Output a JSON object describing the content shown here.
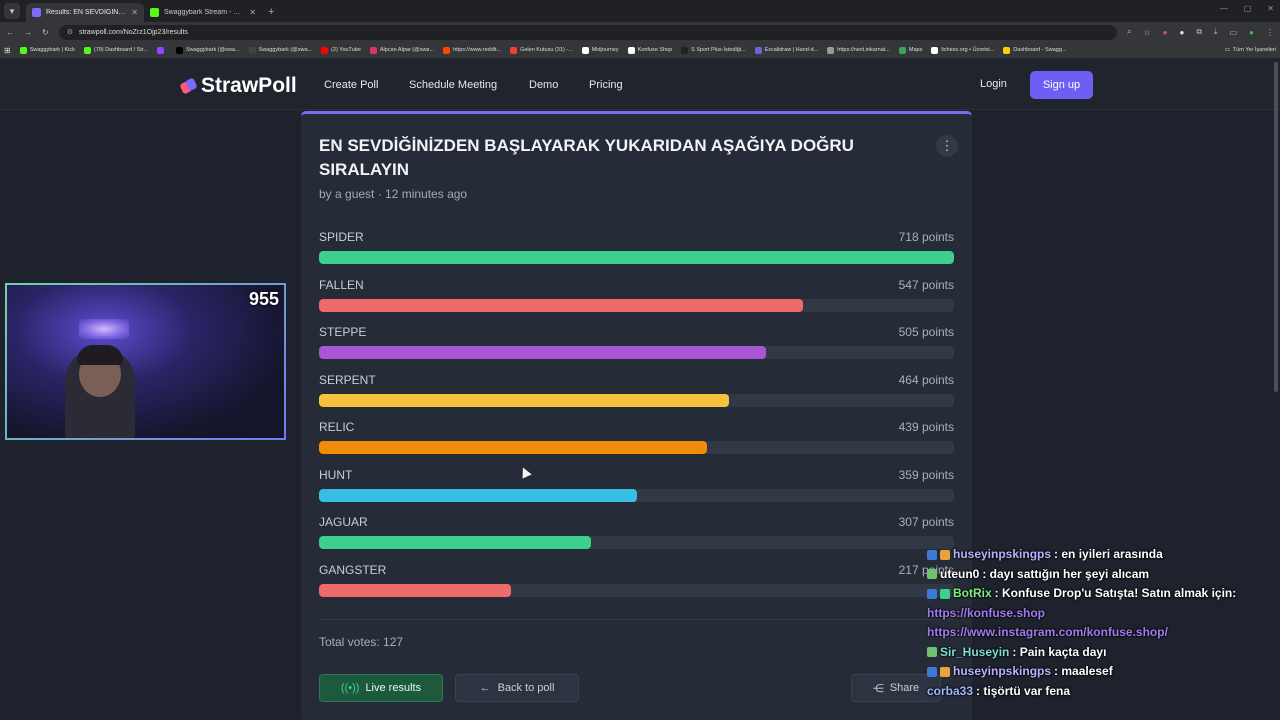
{
  "browser": {
    "tabs": [
      {
        "title": "Results: EN SEVDIĞINIZDEN BAŞ",
        "active": true,
        "favicon_color": "#7a6cf7"
      },
      {
        "title": "Swaggybark Stream - Watch Li...",
        "active": false,
        "favicon_color": "#53fc18"
      }
    ],
    "new_tab": "+",
    "url": "strawpoll.com/NoZrz1Ojp23/results",
    "bookmarks": [
      {
        "label": "Swaggybark | Kick",
        "color": "#53fc18"
      },
      {
        "label": "(79) Dashboard / Str...",
        "color": "#53fc18"
      },
      {
        "label": "",
        "color": "#9146ff"
      },
      {
        "label": "Swaggybark (@swa...",
        "color": "#000000"
      },
      {
        "label": "Swaggybark (@swa...",
        "color": "#444444"
      },
      {
        "label": "(2) YouTube",
        "color": "#ff0000"
      },
      {
        "label": "Alpcan Alpar (@swa...",
        "color": "#e1306c"
      },
      {
        "label": "https://www.reddit...",
        "color": "#ff4500"
      },
      {
        "label": "Gelen Kutusu (31) -...",
        "color": "#ea4335"
      },
      {
        "label": "Midjourney",
        "color": "#ffffff"
      },
      {
        "label": "Konfuse Shop",
        "color": "#ffffff"
      },
      {
        "label": "S Sport Plus-İstediği...",
        "color": "#222222"
      },
      {
        "label": "Excalidraw | Hand-d...",
        "color": "#6965db"
      },
      {
        "label": "https://next.inkarnat...",
        "color": "#999999"
      },
      {
        "label": "Maps",
        "color": "#34a853"
      },
      {
        "label": "lichess.org • Ücretsi...",
        "color": "#ffffff"
      },
      {
        "label": "Dashboard - Swagg...",
        "color": "#ffcc00"
      }
    ],
    "all_bookmarks": "Tüm Yer İşaretleri"
  },
  "site": {
    "logo": "StrawPoll",
    "nav": [
      "Create Poll",
      "Schedule Meeting",
      "Demo",
      "Pricing"
    ],
    "login": "Login",
    "signup": "Sign up"
  },
  "poll": {
    "title": "EN SEVDİĞİNİZDEN BAŞLAYARAK YUKARIDAN AŞAĞIYA DOĞRU SIRALAYIN",
    "byline": "by a guest · 12 minutes ago",
    "max_points": 718,
    "options": [
      {
        "name": "SPIDER",
        "points_label": "718 points",
        "points": 718,
        "color": "#3ecf8e"
      },
      {
        "name": "FALLEN",
        "points_label": "547 points",
        "points": 547,
        "color": "#ef6b6b"
      },
      {
        "name": "STEPPE",
        "points_label": "505 points",
        "points": 505,
        "color": "#a955d6"
      },
      {
        "name": "SERPENT",
        "points_label": "464 points",
        "points": 464,
        "color": "#f6c23e"
      },
      {
        "name": "RELIC",
        "points_label": "439 points",
        "points": 439,
        "color": "#f08c0a"
      },
      {
        "name": "HUNT",
        "points_label": "359 points",
        "points": 359,
        "color": "#38bde4"
      },
      {
        "name": "JAGUAR",
        "points_label": "307 points",
        "points": 307,
        "color": "#3ecf8e"
      },
      {
        "name": "GANGSTER",
        "points_label": "217 points",
        "points": 217,
        "color": "#ef6b6b"
      }
    ],
    "total_votes": "Total votes: 127",
    "live_results": "Live results",
    "back_to_poll": "Back to poll",
    "share": "Share"
  },
  "webcam": {
    "viewer_count": "955"
  },
  "chat": [
    {
      "user": "huseyinpskingps",
      "text": " : en iyileri arasında",
      "user_color": "#b9b2ff",
      "badges": [
        "#3a7bd5",
        "#e8a33d"
      ]
    },
    {
      "user": "uteun0",
      "text": " : dayı sattığın her şeyi alıcam",
      "user_color": "#ffffff",
      "badges": [
        "#6fc36f"
      ]
    },
    {
      "user": "BotRix",
      "text": " : Konfuse Drop'u Satışta! Satın almak için:",
      "user_color": "#7ef07e",
      "badges": [
        "#3a7bd5",
        "#3ecf8e"
      ]
    },
    {
      "link": "https://konfuse.shop"
    },
    {
      "link": "https://www.instagram.com/konfuse.shop/"
    },
    {
      "user": "Sir_Huseyin",
      "text": " : Pain kaçta dayı",
      "user_color": "#7fe0d0",
      "badges": [
        "#6fc36f"
      ]
    },
    {
      "user": "huseyinpskingps",
      "text": " : maalesef",
      "user_color": "#b9b2ff",
      "badges": [
        "#3a7bd5",
        "#e8a33d"
      ]
    },
    {
      "user": "corba33",
      "text": " : tişörtü var fena",
      "user_color": "#9fb8ff",
      "badges": []
    }
  ]
}
